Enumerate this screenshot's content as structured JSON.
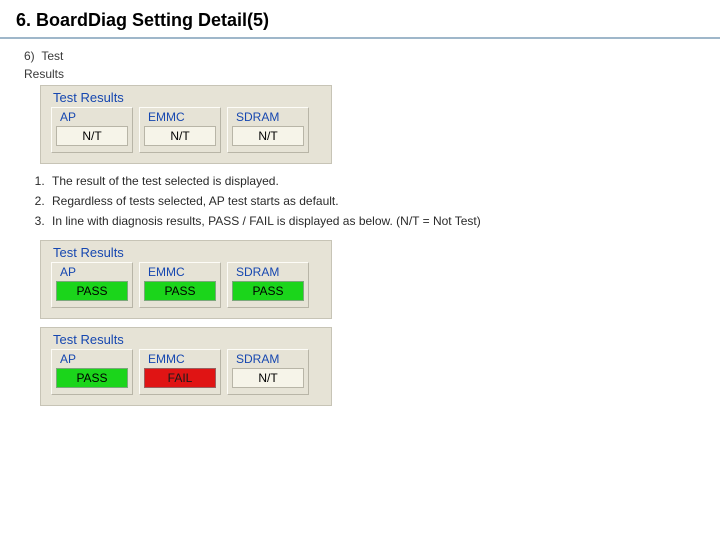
{
  "title": "6. BoardDiag Setting Detail(5)",
  "section": {
    "index": "6)",
    "label": "Test",
    "sublabel": "Results"
  },
  "panel_title": "Test Results",
  "columns": [
    "AP",
    "EMMC",
    "SDRAM"
  ],
  "panels": {
    "nt": {
      "values": [
        "N/T",
        "N/T",
        "N/T"
      ],
      "kinds": [
        "nt",
        "nt",
        "nt"
      ]
    },
    "pass": {
      "values": [
        "PASS",
        "PASS",
        "PASS"
      ],
      "kinds": [
        "pass",
        "pass",
        "pass"
      ]
    },
    "mix": {
      "values": [
        "PASS",
        "FAIL",
        "N/T"
      ],
      "kinds": [
        "pass",
        "fail",
        "nt"
      ]
    }
  },
  "bullets": [
    "The result of the test selected is displayed.",
    "Regardless of tests selected, AP test starts as default.",
    "In line with diagnosis results, PASS / FAIL is displayed as below. (N/T = Not Test)"
  ]
}
